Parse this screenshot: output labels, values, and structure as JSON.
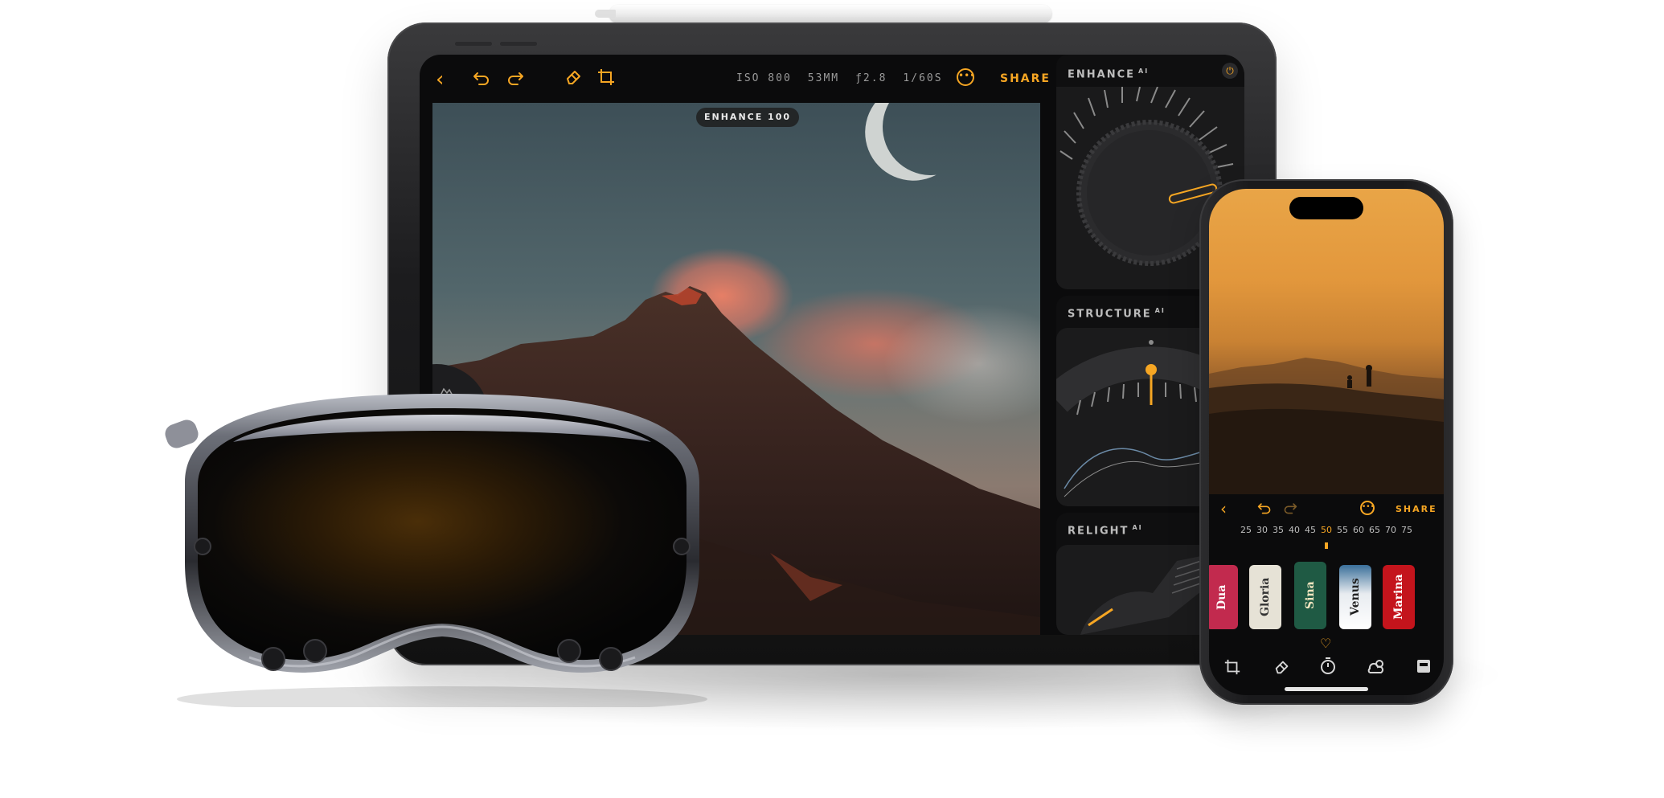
{
  "ipad": {
    "toolbar": {
      "back_icon": "chevron-left-icon",
      "undo_icon": "undo-icon",
      "redo_icon": "redo-icon",
      "eraser_icon": "eraser-icon",
      "crop_icon": "crop-icon",
      "iso": "ISO 800",
      "focal": "53MM",
      "aperture": "ƒ2.8",
      "shutter": "1/60S",
      "more_icon": "ellipsis-circle-icon",
      "share_label": "SHARE"
    },
    "enhance_badge": "ENHANCE 100",
    "panels": {
      "enhance": {
        "title": "ENHANCE",
        "sup": "AI",
        "power_icon": "power-icon"
      },
      "structure": {
        "title": "STRUCTURE",
        "sup": "AI"
      },
      "relight": {
        "title": "RELIGHT",
        "sup": "AI"
      }
    },
    "dial_glyph": "−"
  },
  "iphone": {
    "toolbar": {
      "back_icon": "chevron-left-icon",
      "undo_icon": "undo-icon",
      "redo_icon": "redo-icon",
      "more_icon": "ellipsis-circle-icon",
      "share_label": "SHARE"
    },
    "focal_scale": [
      "25",
      "30",
      "35",
      "40",
      "45",
      "50",
      "55",
      "60",
      "65",
      "70",
      "75"
    ],
    "focal_selected": "50",
    "films": [
      "Dua",
      "Gloria",
      "Sina",
      "Venus",
      "Marina"
    ],
    "favorite_icon": "heart-icon",
    "bottom_tools": [
      "crop-icon",
      "eraser-icon",
      "timer-icon",
      "weather-icon",
      "film-icon"
    ]
  },
  "colors": {
    "accent": "#f6a623",
    "screen_bg": "#0b0b0c",
    "panel_bg": "#151516",
    "meta_text": "#9a9a9a"
  }
}
